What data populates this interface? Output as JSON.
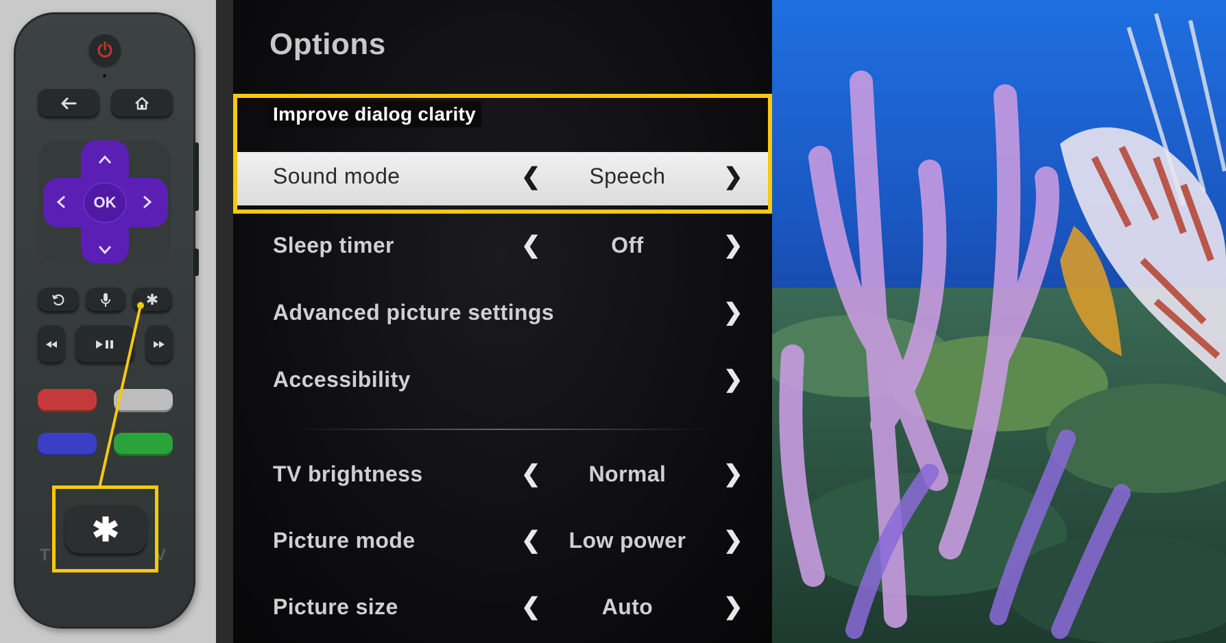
{
  "remote": {
    "dpad_ok": "OK",
    "star_symbol": "✱",
    "brand_left": "T",
    "brand_right": "V",
    "icons": [
      "power-icon",
      "back-icon",
      "home-icon",
      "up-icon",
      "down-icon",
      "left-icon",
      "right-icon",
      "replay-icon",
      "mic-icon",
      "options-icon",
      "rewind-icon",
      "play-pause-icon",
      "fast-forward-icon"
    ],
    "colors": {
      "power": "#c0392b",
      "dpad": "#5b1fb5",
      "red": "#c43a3a",
      "white": "#bdbdbd",
      "blue": "#3b3fc4",
      "green": "#2aa33a",
      "highlight": "#f6c90e"
    }
  },
  "options": {
    "title": "Options",
    "tooltip": "Improve dialog clarity",
    "rows": [
      {
        "label": "Sound mode",
        "value": "Speech",
        "selected": true
      },
      {
        "label": "Sleep timer",
        "value": "Off"
      },
      {
        "label": "Advanced picture settings",
        "value": ""
      },
      {
        "label": "Accessibility",
        "value": ""
      },
      {
        "label": "TV brightness",
        "value": "Normal"
      },
      {
        "label": "Picture mode",
        "value": "Low power"
      },
      {
        "label": "Picture size",
        "value": "Auto"
      }
    ],
    "chevron_left": "❮",
    "chevron_right": "❯"
  }
}
